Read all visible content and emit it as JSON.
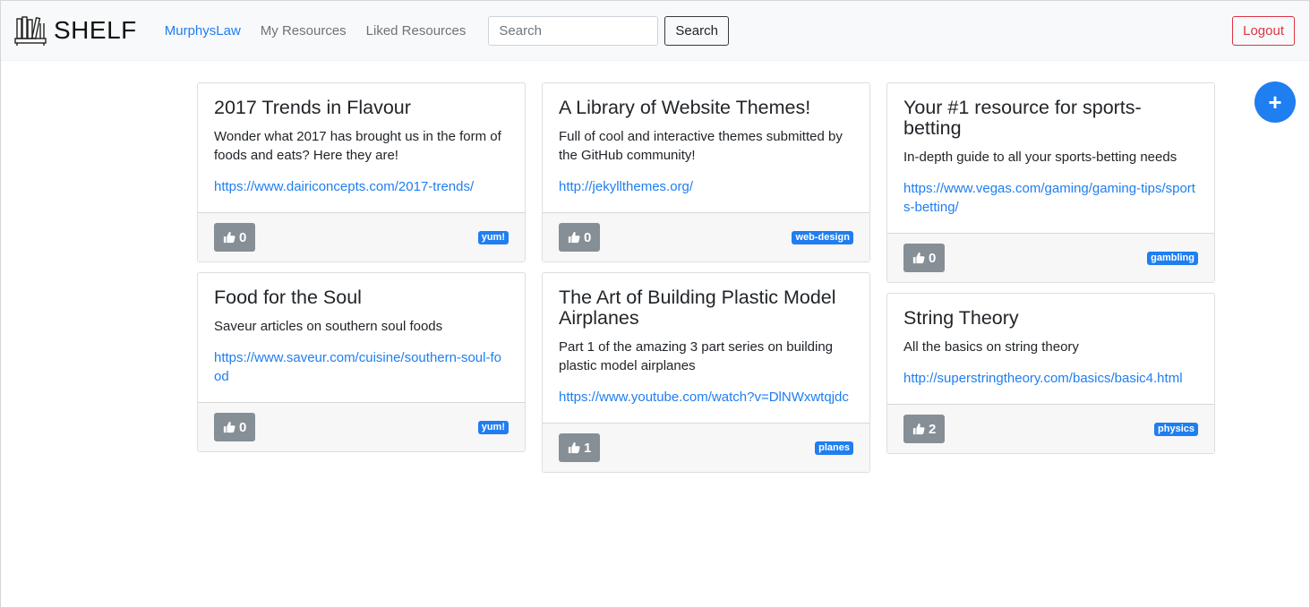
{
  "navbar": {
    "brand": "SHELF",
    "brand_icon": "bookshelf-icon",
    "links": [
      {
        "label": "MurphysLaw"
      },
      {
        "label": "My Resources"
      },
      {
        "label": "Liked Resources"
      }
    ],
    "search_placeholder": "Search",
    "search_button": "Search",
    "logout_button": "Logout"
  },
  "fab": {
    "label": "+",
    "icon": "plus-icon"
  },
  "accent_color": "#1f7ef0",
  "columns": [
    [
      {
        "title": "2017 Trends in Flavour",
        "description": "Wonder what 2017 has brought us in the form of foods and eats? Here they are!",
        "link": "https://www.dairiconcepts.com/2017-trends/",
        "likes": "0",
        "tag": "yum!"
      },
      {
        "title": "Food for the Soul",
        "description": "Saveur articles on southern soul foods",
        "link": "https://www.saveur.com/cuisine/southern-soul-food",
        "likes": "0",
        "tag": "yum!"
      }
    ],
    [
      {
        "title": "A Library of Website Themes!",
        "description": "Full of cool and interactive themes submitted by the GitHub community!",
        "link": "http://jekyllthemes.org/",
        "likes": "0",
        "tag": "web-design"
      },
      {
        "title": "The Art of Building Plastic Model Airplanes",
        "description": "Part 1 of the amazing 3 part series on building plastic model airplanes",
        "link": "https://www.youtube.com/watch?v=DlNWxwtqjdc",
        "likes": "1",
        "tag": "planes"
      }
    ],
    [
      {
        "title": "Your #1 resource for sports-betting",
        "description": "In-depth guide to all your sports-betting needs",
        "link": "https://www.vegas.com/gaming/gaming-tips/sports-betting/",
        "likes": "0",
        "tag": "gambling"
      },
      {
        "title": "String Theory",
        "description": "All the basics on string theory",
        "link": "http://superstringtheory.com/basics/basic4.html",
        "likes": "2",
        "tag": "physics"
      }
    ]
  ]
}
